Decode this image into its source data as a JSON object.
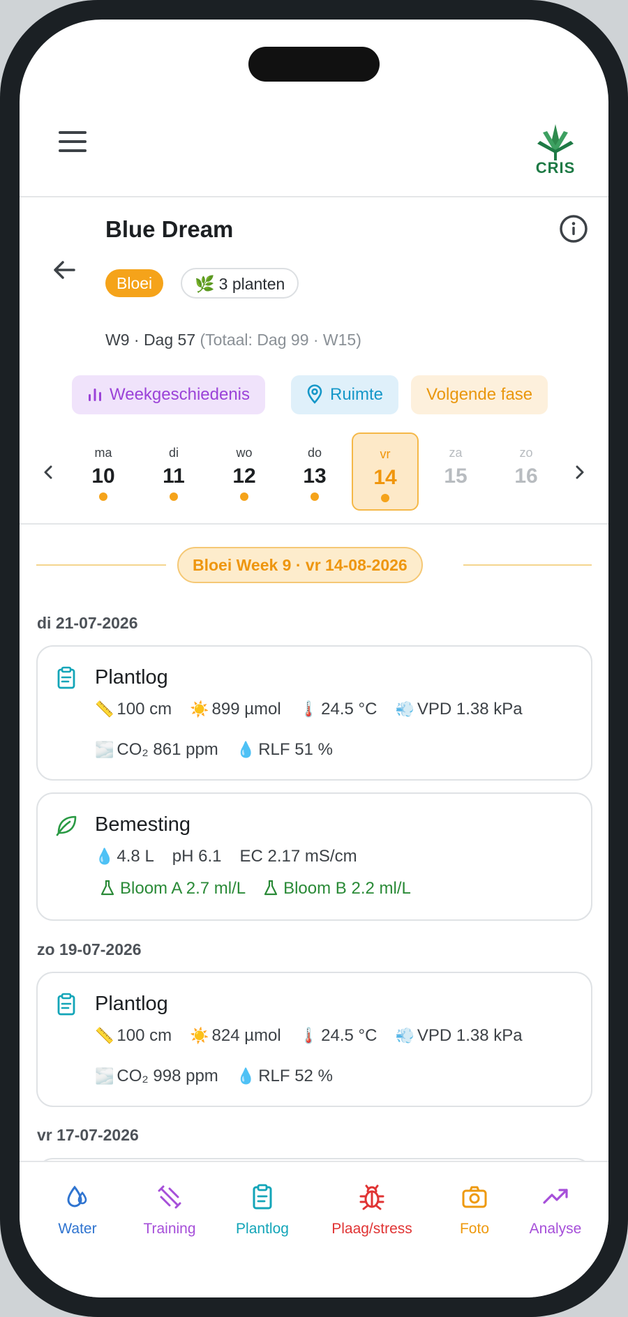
{
  "app": {
    "logo_text": "CRIS"
  },
  "header": {
    "title": "Blue Dream",
    "phase_badge": "Bloei",
    "plants_icon": "🌿",
    "plants_badge": "3 planten",
    "week_day": "W9 · Dag 57",
    "total": "(Totaal: Dag 99 · W15)"
  },
  "actions": {
    "history": "Weekgeschiedenis",
    "room": "Ruimte",
    "next_phase": "Volgende fase"
  },
  "days": [
    {
      "name": "ma",
      "date": "10",
      "has_entry": true,
      "selected": false,
      "future": false
    },
    {
      "name": "di",
      "date": "11",
      "has_entry": true,
      "selected": false,
      "future": false
    },
    {
      "name": "wo",
      "date": "12",
      "has_entry": true,
      "selected": false,
      "future": false
    },
    {
      "name": "do",
      "date": "13",
      "has_entry": true,
      "selected": false,
      "future": false
    },
    {
      "name": "vr",
      "date": "14",
      "has_entry": true,
      "selected": true,
      "future": false
    },
    {
      "name": "za",
      "date": "15",
      "has_entry": false,
      "selected": false,
      "future": true
    },
    {
      "name": "zo",
      "date": "16",
      "has_entry": false,
      "selected": false,
      "future": true
    }
  ],
  "week_banner": "Bloei Week 9 · vr 14-08-2026",
  "entries": {
    "date1": "di 21-07-2026",
    "plantlog1": {
      "title": "Plantlog",
      "height": "100 cm",
      "light": "899 µmol",
      "temp": "24.5 °C",
      "vpd": "VPD 1.38 kPa",
      "co2": "CO₂ 861 ppm",
      "rh": "RLF 51 %"
    },
    "feeding": {
      "title": "Bemesting",
      "volume": "4.8 L",
      "ph": "pH 6.1",
      "ec": "EC 2.17 mS/cm",
      "nutrient_a": "Bloom A 2.7 ml/L",
      "nutrient_b": "Bloom B 2.2 ml/L"
    },
    "date2": "zo 19-07-2026",
    "plantlog2": {
      "title": "Plantlog",
      "height": "100 cm",
      "light": "824 µmol",
      "temp": "24.5 °C",
      "vpd": "VPD 1.38 kPa",
      "co2": "CO₂ 998 ppm",
      "rh": "RLF 52 %"
    },
    "date3": "vr 17-07-2026"
  },
  "emoji": {
    "ruler": "📏",
    "sun": "☀️",
    "thermo": "🌡️",
    "wind": "💨",
    "fog": "🌫️",
    "drop": "💧"
  },
  "nav": [
    {
      "label": "Water",
      "icon": "water-drops-icon",
      "color": "#2f74d0"
    },
    {
      "label": "Training",
      "icon": "training-icon",
      "color": "#a64fd9"
    },
    {
      "label": "Plantlog",
      "icon": "clipboard-icon",
      "color": "#13a5b8"
    },
    {
      "label": "Plaag/stress",
      "icon": "bug-icon",
      "color": "#e03434"
    },
    {
      "label": "Foto",
      "icon": "camera-icon",
      "color": "#ee9a10"
    },
    {
      "label": "Analyse",
      "icon": "trend-up-icon",
      "color": "#a64fd9"
    }
  ],
  "colors": {
    "accent": "#f5a31a",
    "green": "#2a8a37",
    "teal": "#13a5b8"
  }
}
